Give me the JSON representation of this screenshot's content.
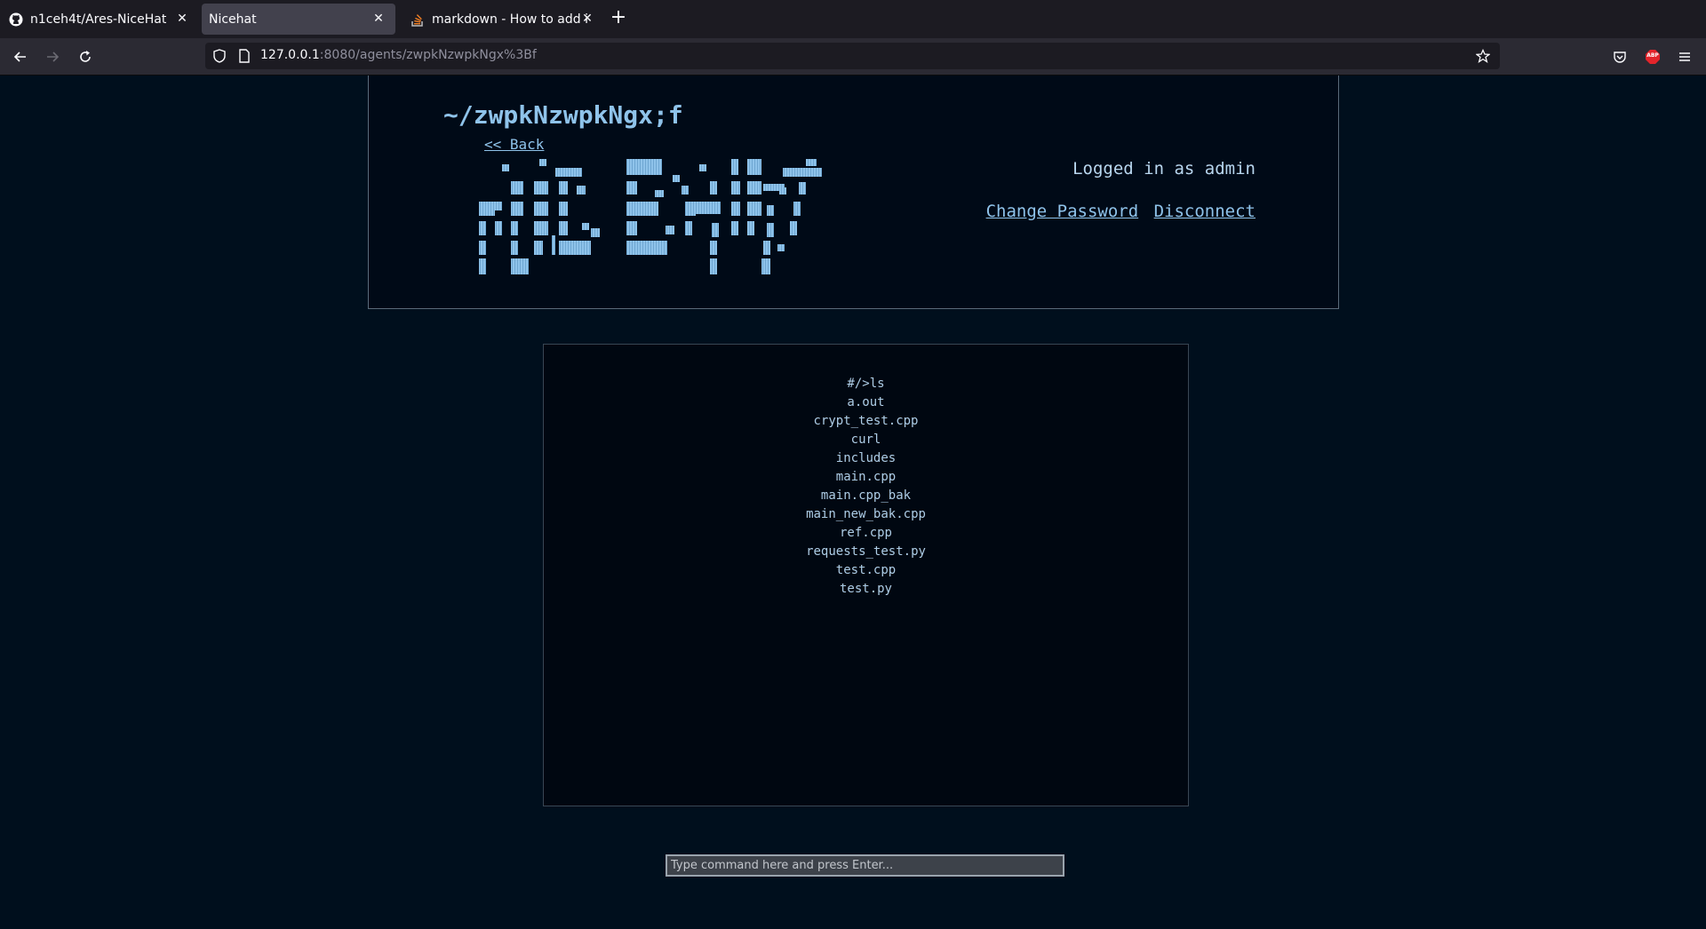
{
  "browser": {
    "tabs": [
      {
        "title": "n1ceh4t/Ares-NiceHat",
        "icon": "github-icon",
        "active": false
      },
      {
        "title": "Nicehat",
        "icon": "",
        "active": true
      },
      {
        "title": "markdown - How to add im",
        "icon": "stackoverflow-icon",
        "active": false
      }
    ],
    "url_host": "127.0.0.1",
    "url_rest": ":8080/agents/zwpkNzwpkNgx%3Bf",
    "extension_badge": "ABP"
  },
  "header": {
    "agent_title": "~/zwpkNzwpkNgx;f",
    "back_label": "<< Back",
    "logged_in_text": "Logged in as admin",
    "change_password_label": "Change Password",
    "disconnect_label": "Disconnect",
    "logo_text": "NICEHAT"
  },
  "console": {
    "lines": [
      "#/>ls",
      "a.out",
      "crypt_test.cpp",
      "curl",
      "includes",
      "main.cpp",
      "main.cpp_bak",
      "main_new_bak.cpp",
      "ref.cpp",
      "requests_test.py",
      "test.cpp",
      "test.py"
    ]
  },
  "command_input": {
    "placeholder": "Type command here and press Enter...",
    "value": ""
  },
  "colors": {
    "page_bg": "#000f1d",
    "accent": "#8fc3ea"
  }
}
